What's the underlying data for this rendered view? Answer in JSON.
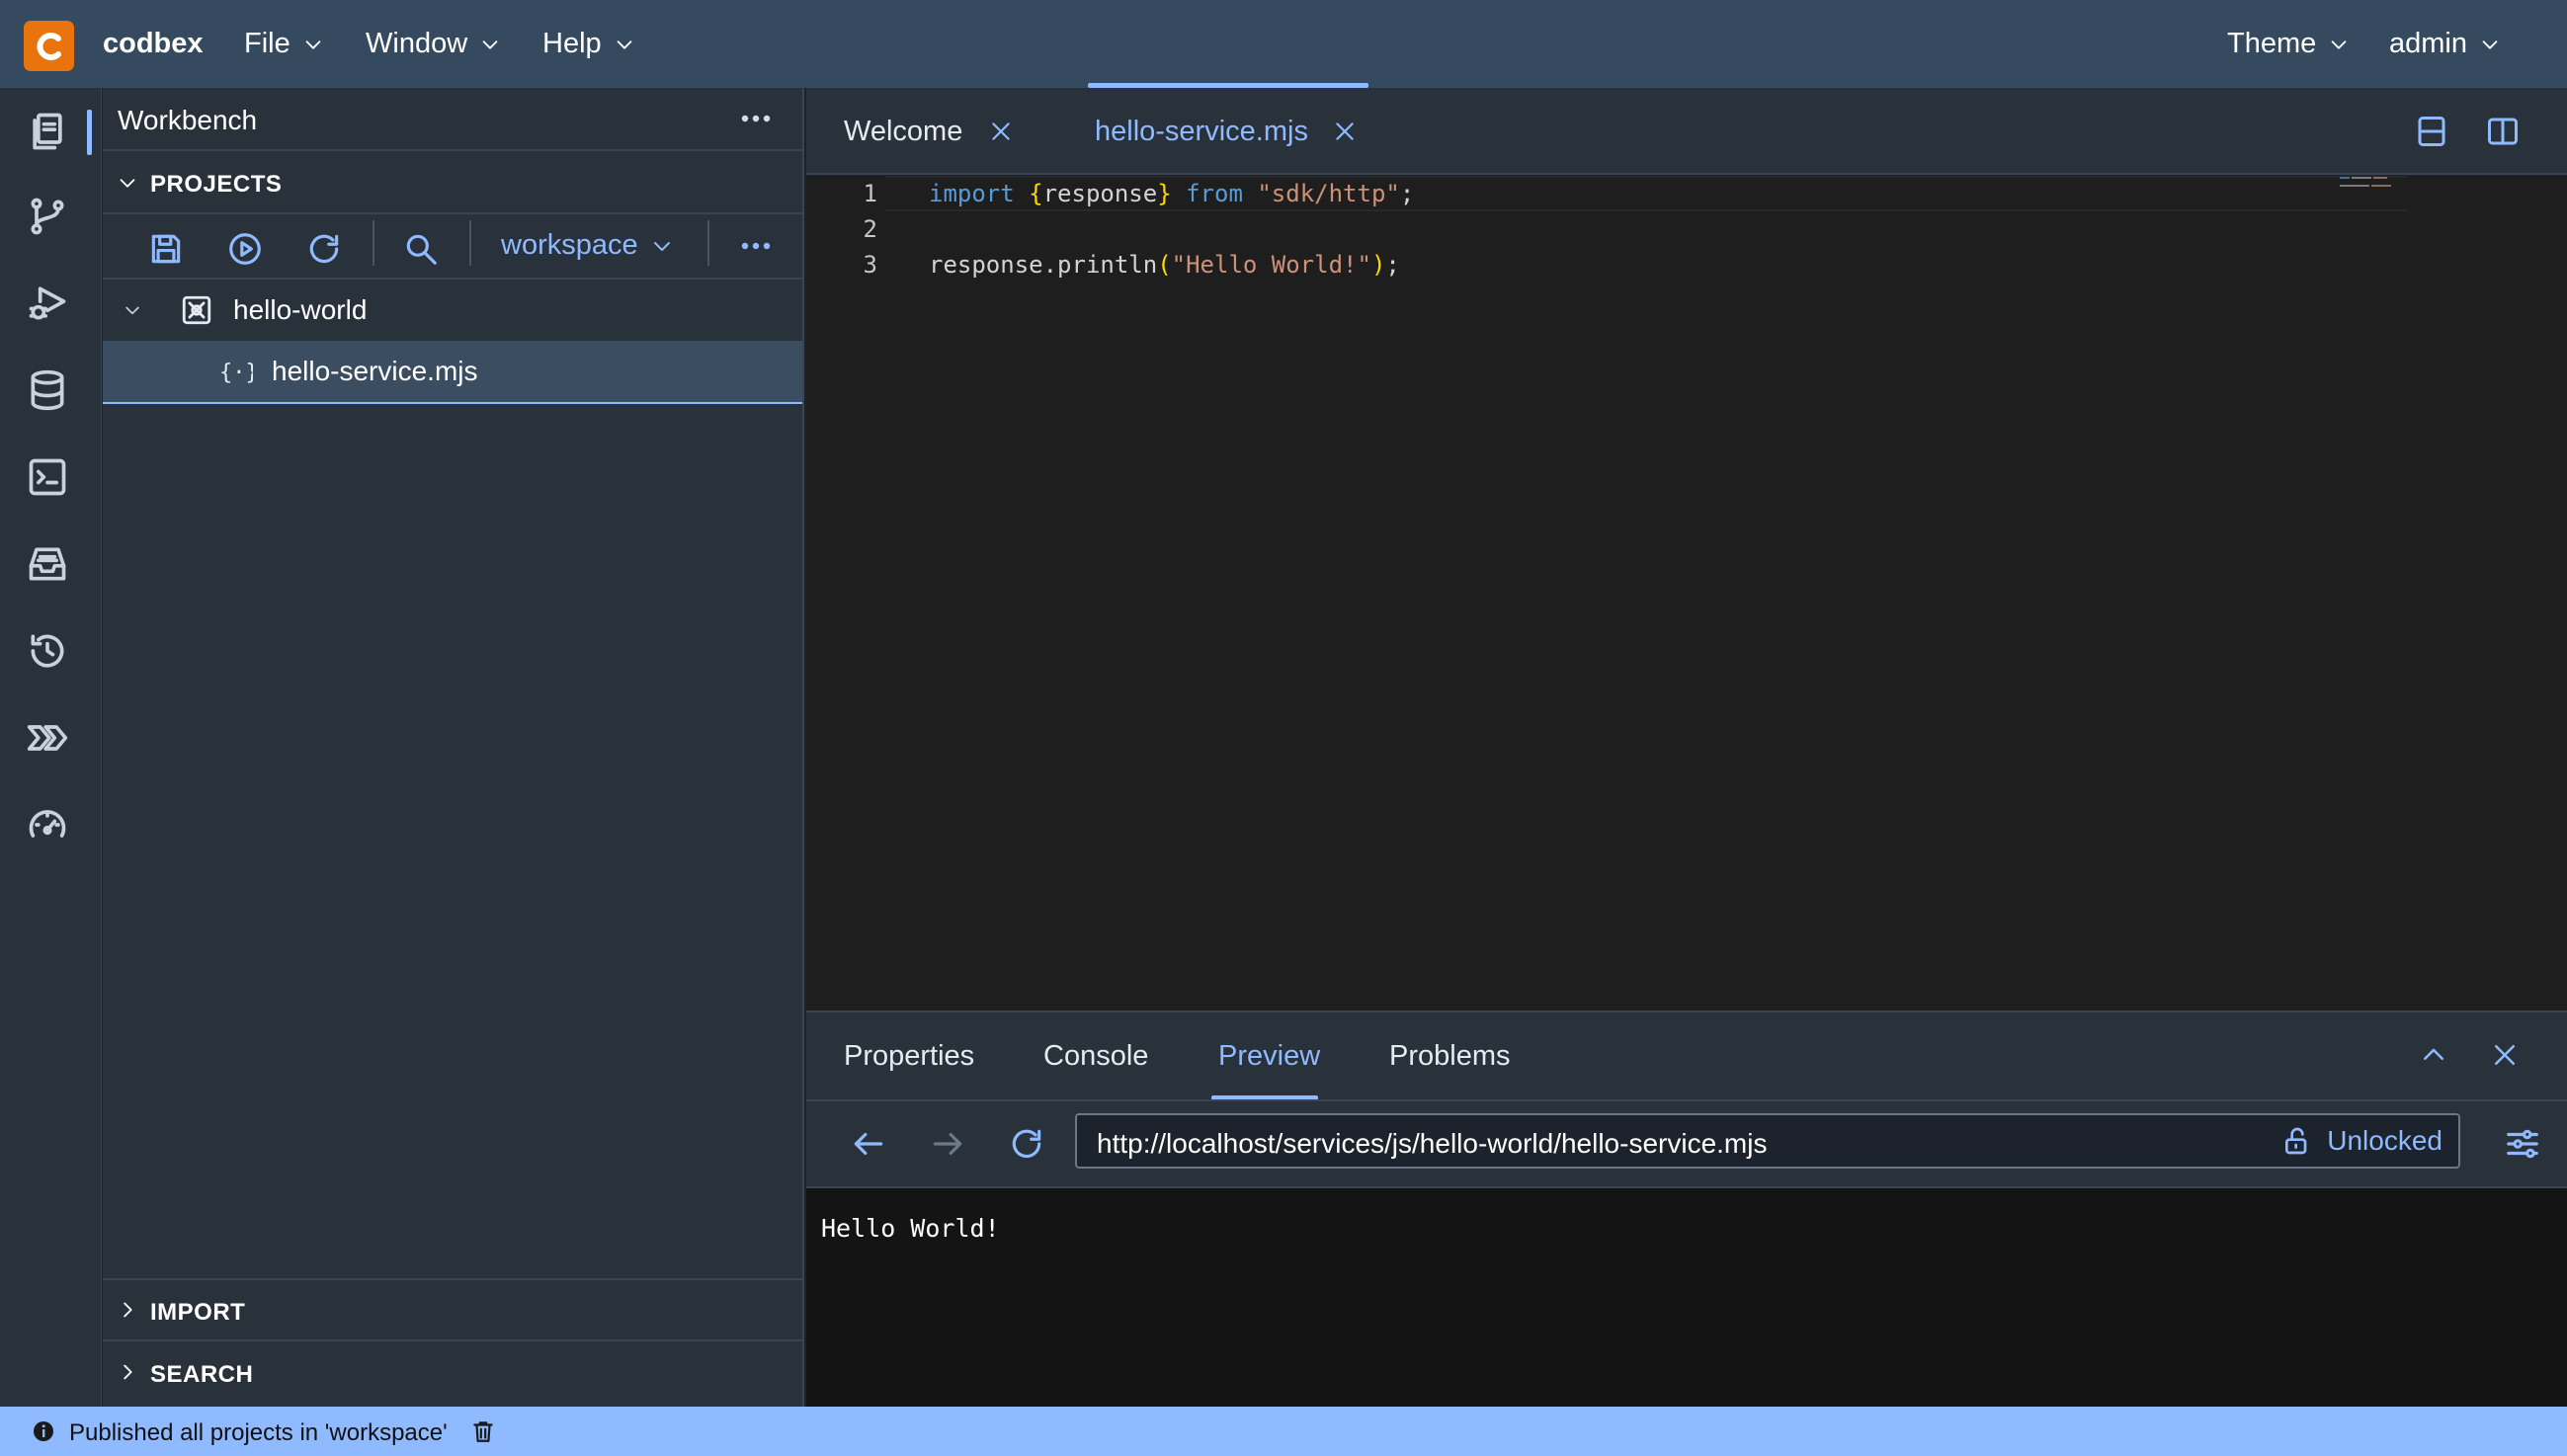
{
  "app": {
    "brand": "codbex"
  },
  "menu": {
    "file": "File",
    "window": "Window",
    "help": "Help",
    "theme": "Theme",
    "user": "admin"
  },
  "workbench": {
    "title": "Workbench",
    "projects_label": "PROJECTS",
    "workspace": "workspace",
    "tree": {
      "project": "hello-world",
      "file": "hello-service.mjs"
    },
    "import_label": "IMPORT",
    "search_label": "SEARCH"
  },
  "editor": {
    "tabs": [
      {
        "label": "Welcome"
      },
      {
        "label": "hello-service.mjs",
        "active": true
      }
    ],
    "lines": [
      {
        "num": "1",
        "text": "import {response} from \"sdk/http\";"
      },
      {
        "num": "2",
        "text": ""
      },
      {
        "num": "3",
        "text": "response.println(\"Hello World!\");"
      }
    ],
    "tokens": {
      "import": "import",
      "brace_open": "{",
      "response": "response",
      "brace_close": "}",
      "from": "from",
      "module": "\"sdk/http\"",
      "semi": ";",
      "call": "response.println",
      "paren_open": "(",
      "hello": "\"Hello World!\"",
      "paren_close": ")"
    }
  },
  "bottom": {
    "tabs": [
      "Properties",
      "Console",
      "Preview",
      "Problems"
    ],
    "active_tab": "Preview",
    "url": "http://localhost/services/js/hello-world/hello-service.mjs",
    "lock_label": "Unlocked",
    "output": "Hello World!"
  },
  "status": {
    "message": "Published all projects in 'workspace'"
  },
  "colors": {
    "topbar": "#354a5f",
    "accent": "#8fbaff",
    "logo": "#e9730c",
    "panel": "#29313a",
    "editor_bg": "#1e1e1e",
    "status_bg": "#8fbaff"
  },
  "icons": {
    "activity": [
      "projects-icon",
      "git-branch-icon",
      "debug-icon",
      "database-icon",
      "terminal-icon",
      "inbox-icon",
      "history-icon",
      "operations-icon",
      "performance-icon"
    ]
  }
}
